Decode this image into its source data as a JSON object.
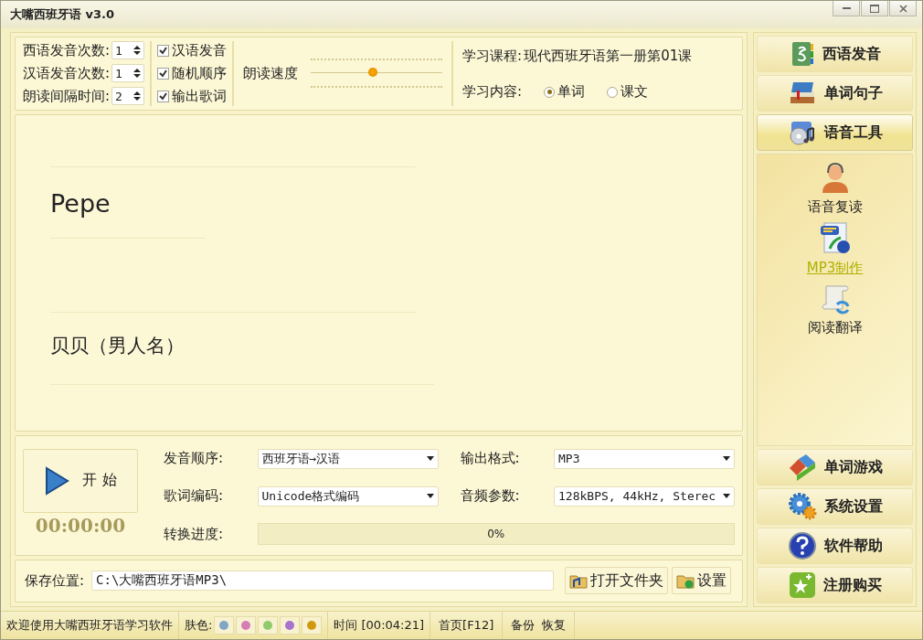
{
  "window": {
    "title": "大嘴西班牙语 v3.0"
  },
  "settings": {
    "spinners": [
      {
        "label": "西语发音次数:",
        "value": "1"
      },
      {
        "label": "汉语发音次数:",
        "value": "1"
      },
      {
        "label": "朗读间隔时间:",
        "value": "2"
      }
    ],
    "checkboxes": [
      {
        "label": "汉语发音",
        "checked": true
      },
      {
        "label": "随机顺序",
        "checked": true
      },
      {
        "label": "输出歌词",
        "checked": true
      }
    ],
    "speed": {
      "label": "朗读速度",
      "level": 0.47
    },
    "course": {
      "label": "学习课程:",
      "value": "现代西班牙语第一册第01课"
    },
    "content": {
      "label": "学习内容:",
      "options": [
        {
          "label": "单词",
          "selected": true
        },
        {
          "label": "课文",
          "selected": false
        }
      ]
    }
  },
  "display": {
    "word": "Pepe",
    "meaning": "贝贝（男人名）"
  },
  "convert": {
    "start_button": "开 始",
    "timer": "00:00:00",
    "fields": [
      {
        "label": "发音顺序:",
        "value": "西班牙语→汉语"
      },
      {
        "label": "输出格式:",
        "value": "MP3"
      },
      {
        "label": "歌词编码:",
        "value": "Unicode格式编码"
      },
      {
        "label": "音频参数:",
        "value": "128kBPS, 44kHz, Sterec"
      }
    ],
    "progress": {
      "label": "转换进度:",
      "level": 0,
      "reading": "0%"
    }
  },
  "save": {
    "label": "保存位置:",
    "value": "C:\\大嘴西班牙语MP3\\",
    "buttons": [
      "打开文件夹",
      "设置"
    ]
  },
  "sidebar": {
    "top": [
      {
        "label": "西语发音",
        "selected": false
      },
      {
        "label": "单词句子",
        "selected": false
      },
      {
        "label": "语音工具",
        "selected": true
      }
    ],
    "tools": [
      {
        "label": "语音复读",
        "selected": false
      },
      {
        "label": "MP3制作",
        "selected": true
      },
      {
        "label": "阅读翻译",
        "selected": false
      }
    ],
    "bottom": [
      "单词游戏",
      "系统设置",
      "软件帮助",
      "注册购买"
    ]
  },
  "status_bar": {
    "welcome": "欢迎使用大嘴西班牙语学习软件",
    "skin_label": "肤色:",
    "skins": [
      {
        "color": "#7fa6c6"
      },
      {
        "color": "#d57fb4"
      },
      {
        "color": "#8fca6e"
      },
      {
        "color": "#a872cf"
      },
      {
        "color": "#d09a10"
      }
    ],
    "time": "时间 [00:04:21]",
    "home": "首页[F12]",
    "backup": "备份",
    "restore": "恢复"
  }
}
